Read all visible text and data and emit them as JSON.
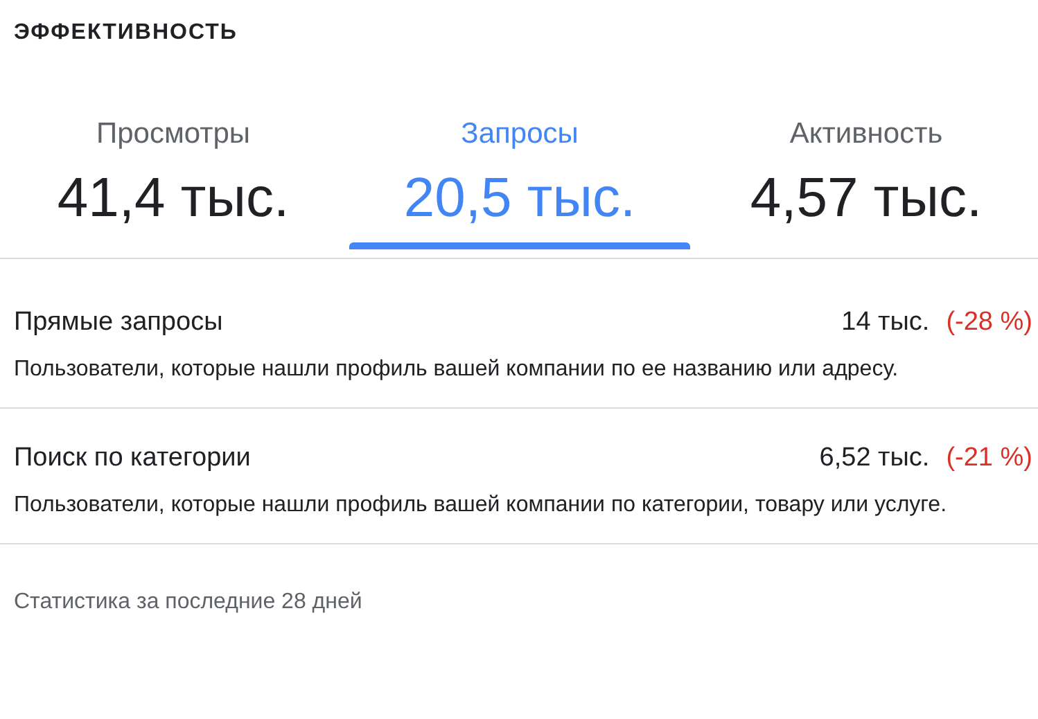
{
  "section_title": "ЭФФЕКТИВНОСТЬ",
  "tabs": [
    {
      "label": "Просмотры",
      "value": "41,4 тыс.",
      "selected": false
    },
    {
      "label": "Запросы",
      "value": "20,5 тыс.",
      "selected": true
    },
    {
      "label": "Активность",
      "value": "4,57 тыс.",
      "selected": false
    }
  ],
  "metrics": [
    {
      "name": "Прямые запросы",
      "value": "14 тыс.",
      "change": "(-28 %)",
      "description": "Пользователи, которые нашли профиль вашей компании по ее названию или адресу."
    },
    {
      "name": "Поиск по категории",
      "value": "6,52 тыс.",
      "change": "(-21 %)",
      "description": "Пользователи, которые нашли профиль вашей компании по категории, товару или услуге."
    }
  ],
  "footer": "Статистика за последние 28 дней"
}
